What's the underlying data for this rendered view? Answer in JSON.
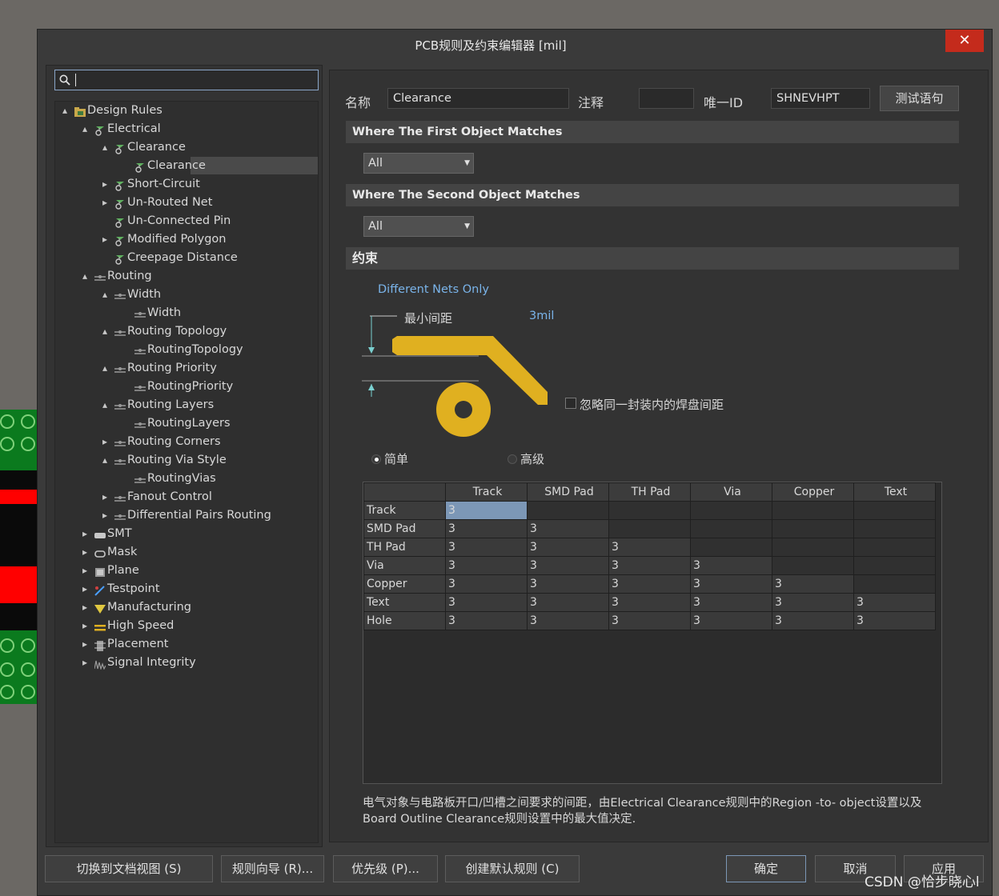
{
  "window": {
    "title": "PCB规则及约束编辑器 [mil]",
    "close_label": "✕"
  },
  "search": {
    "value": ""
  },
  "tree": [
    {
      "label": "Design Rules",
      "level": 0,
      "arrow": "▲",
      "icon": "folder-icon"
    },
    {
      "label": "Electrical",
      "level": 1,
      "arrow": "▲",
      "icon": "electrical-rule-icon"
    },
    {
      "label": "Clearance",
      "level": 2,
      "arrow": "▲",
      "icon": "electrical-rule-icon"
    },
    {
      "label": "Clearance",
      "level": 3,
      "arrow": "",
      "icon": "electrical-rule-icon",
      "selected": true
    },
    {
      "label": "Short-Circuit",
      "level": 2,
      "arrow": "▶",
      "icon": "electrical-rule-icon"
    },
    {
      "label": "Un-Routed Net",
      "level": 2,
      "arrow": "▶",
      "icon": "electrical-rule-icon"
    },
    {
      "label": "Un-Connected Pin",
      "level": 2,
      "arrow": "",
      "icon": "electrical-rule-icon"
    },
    {
      "label": "Modified Polygon",
      "level": 2,
      "arrow": "▶",
      "icon": "electrical-rule-icon"
    },
    {
      "label": "Creepage Distance",
      "level": 2,
      "arrow": "",
      "icon": "electrical-rule-icon"
    },
    {
      "label": "Routing",
      "level": 1,
      "arrow": "▲",
      "icon": "routing-rule-icon"
    },
    {
      "label": "Width",
      "level": 2,
      "arrow": "▲",
      "icon": "routing-rule-icon"
    },
    {
      "label": "Width",
      "level": 3,
      "arrow": "",
      "icon": "routing-rule-icon"
    },
    {
      "label": "Routing Topology",
      "level": 2,
      "arrow": "▲",
      "icon": "routing-rule-icon"
    },
    {
      "label": "RoutingTopology",
      "level": 3,
      "arrow": "",
      "icon": "routing-rule-icon"
    },
    {
      "label": "Routing Priority",
      "level": 2,
      "arrow": "▲",
      "icon": "routing-rule-icon"
    },
    {
      "label": "RoutingPriority",
      "level": 3,
      "arrow": "",
      "icon": "routing-rule-icon"
    },
    {
      "label": "Routing Layers",
      "level": 2,
      "arrow": "▲",
      "icon": "routing-rule-icon"
    },
    {
      "label": "RoutingLayers",
      "level": 3,
      "arrow": "",
      "icon": "routing-rule-icon"
    },
    {
      "label": "Routing Corners",
      "level": 2,
      "arrow": "▶",
      "icon": "routing-rule-icon"
    },
    {
      "label": "Routing Via Style",
      "level": 2,
      "arrow": "▲",
      "icon": "routing-rule-icon"
    },
    {
      "label": "RoutingVias",
      "level": 3,
      "arrow": "",
      "icon": "routing-rule-icon"
    },
    {
      "label": "Fanout Control",
      "level": 2,
      "arrow": "▶",
      "icon": "routing-rule-icon"
    },
    {
      "label": "Differential Pairs Routing",
      "level": 2,
      "arrow": "▶",
      "icon": "routing-rule-icon"
    },
    {
      "label": "SMT",
      "level": 1,
      "arrow": "▶",
      "icon": "smt-rule-icon"
    },
    {
      "label": "Mask",
      "level": 1,
      "arrow": "▶",
      "icon": "mask-rule-icon"
    },
    {
      "label": "Plane",
      "level": 1,
      "arrow": "▶",
      "icon": "plane-rule-icon"
    },
    {
      "label": "Testpoint",
      "level": 1,
      "arrow": "▶",
      "icon": "testpoint-rule-icon"
    },
    {
      "label": "Manufacturing",
      "level": 1,
      "arrow": "▶",
      "icon": "manufacturing-rule-icon"
    },
    {
      "label": "High Speed",
      "level": 1,
      "arrow": "▶",
      "icon": "high-speed-rule-icon"
    },
    {
      "label": "Placement",
      "level": 1,
      "arrow": "▶",
      "icon": "placement-rule-icon"
    },
    {
      "label": "Signal Integrity",
      "level": 1,
      "arrow": "▶",
      "icon": "signal-integrity-rule-icon"
    }
  ],
  "form": {
    "name_label": "名称",
    "name_value": "Clearance",
    "comment_label": "注释",
    "comment_value": "",
    "uid_label": "唯一ID",
    "uid_value": "SHNEVHPT",
    "test_button": "测试语句"
  },
  "first_match": {
    "header": "Where The First Object Matches",
    "value": "All"
  },
  "second_match": {
    "header": "Where The Second Object Matches",
    "value": "All"
  },
  "constraints": {
    "header": "约束",
    "net_scope": "Different Nets Only",
    "min_clearance_label": "最小间距",
    "min_clearance_value": "3mil",
    "ignore_pads_label": "忽略同一封装内的焊盘间距",
    "ignore_pads_checked": false,
    "mode_simple": "简单",
    "mode_advanced": "高级",
    "mode_selected": "简单"
  },
  "matrix": {
    "columns": [
      "Track",
      "SMD Pad",
      "TH Pad",
      "Via",
      "Copper",
      "Text"
    ],
    "rows": [
      {
        "name": "Track",
        "values": [
          "3",
          "",
          "",
          "",
          "",
          ""
        ]
      },
      {
        "name": "SMD Pad",
        "values": [
          "3",
          "3",
          "",
          "",
          "",
          ""
        ]
      },
      {
        "name": "TH Pad",
        "values": [
          "3",
          "3",
          "3",
          "",
          "",
          ""
        ]
      },
      {
        "name": "Via",
        "values": [
          "3",
          "3",
          "3",
          "3",
          "",
          ""
        ]
      },
      {
        "name": "Copper",
        "values": [
          "3",
          "3",
          "3",
          "3",
          "3",
          ""
        ]
      },
      {
        "name": "Text",
        "values": [
          "3",
          "3",
          "3",
          "3",
          "3",
          "3"
        ]
      },
      {
        "name": "Hole",
        "values": [
          "3",
          "3",
          "3",
          "3",
          "3",
          "3"
        ]
      }
    ]
  },
  "description_line1": "电气对象与电路板开口/凹槽之间要求的间距，由Electrical Clearance规则中的Region -to- object设置以及",
  "description_line2": "Board Outline Clearance规则设置中的最大值决定.",
  "bottom": {
    "doc_view": "切换到文档视图 (S)",
    "wizard": "规则向导 (R)...",
    "priority": "优先级 (P)...",
    "defaults": "创建默认规则 (C)",
    "ok": "确定",
    "cancel": "取消",
    "apply": "应用"
  },
  "watermark": "CSDN @恰步晓心l",
  "colors": {
    "accent": "#7c97b6",
    "copper": "#e0b020",
    "close": "#c42b1c",
    "link": "#7ab4ea"
  }
}
